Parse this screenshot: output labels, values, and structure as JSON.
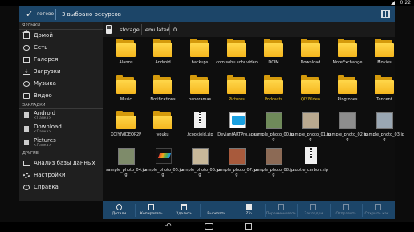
{
  "status": {
    "time": "0:22"
  },
  "actionbar": {
    "done_label": "готово",
    "title": "3 выбрано ресурсов",
    "icons": [
      "check-icon",
      "grid-view-icon"
    ]
  },
  "sidebar": {
    "sections": {
      "bookmarks_header": "ЯРЛЫКИ",
      "tabs_header": "ЗАКЛАДКИ",
      "other_header": "ДРУГИЕ"
    },
    "shortcuts": [
      {
        "label": "Домой",
        "icon": "home-icon"
      },
      {
        "label": "Сеть",
        "icon": "network-icon"
      },
      {
        "label": "Галерея",
        "icon": "gallery-icon"
      },
      {
        "label": "Загрузки",
        "icon": "download-icon"
      },
      {
        "label": "Музыка",
        "icon": "music-icon"
      },
      {
        "label": "Видео",
        "icon": "video-icon"
      }
    ],
    "bookmarks": [
      {
        "label": "Android",
        "sub": "<Папка>"
      },
      {
        "label": "Download",
        "sub": "<Папка>"
      },
      {
        "label": "Pictures",
        "sub": "<Папка>"
      }
    ],
    "other": [
      {
        "label": "Анализ базы данных",
        "icon": "analysis-icon"
      },
      {
        "label": "Настройки",
        "icon": "gear-icon"
      },
      {
        "label": "Справка",
        "icon": "help-icon"
      }
    ]
  },
  "path": {
    "crumbs": [
      "storage",
      "emulated",
      "0"
    ]
  },
  "files": [
    {
      "name": "Alarms",
      "kind": "folder",
      "highlight": false
    },
    {
      "name": "Android",
      "kind": "folder",
      "highlight": false
    },
    {
      "name": "backups",
      "kind": "folder",
      "highlight": false
    },
    {
      "name": "com.sohu.sohuvideo",
      "kind": "folder",
      "highlight": false
    },
    {
      "name": "DCIM",
      "kind": "folder",
      "highlight": false
    },
    {
      "name": "Download",
      "kind": "folder",
      "highlight": false
    },
    {
      "name": "MoreExchange",
      "kind": "folder",
      "highlight": false
    },
    {
      "name": "Movies",
      "kind": "folder",
      "highlight": false
    },
    {
      "name": "Music",
      "kind": "folder",
      "highlight": false
    },
    {
      "name": "Notifications",
      "kind": "folder",
      "highlight": false
    },
    {
      "name": "panoramas",
      "kind": "folder",
      "highlight": false
    },
    {
      "name": "Pictures",
      "kind": "folder",
      "highlight": true
    },
    {
      "name": "Podcasts",
      "kind": "folder",
      "highlight": true
    },
    {
      "name": "QIYIVideo",
      "kind": "folder",
      "highlight": true
    },
    {
      "name": "Ringtones",
      "kind": "folder",
      "highlight": false
    },
    {
      "name": "Tencent",
      "kind": "folder",
      "highlight": false
    },
    {
      "name": "XQIYIVIDEOP2P",
      "kind": "folder",
      "highlight": false
    },
    {
      "name": "youku",
      "kind": "folder",
      "highlight": false
    },
    {
      "name": ".tcookieid.zip",
      "kind": "zip",
      "highlight": false
    },
    {
      "name": "DeviantARTPro.apk",
      "kind": "apk",
      "highlight": false
    },
    {
      "name": "sample_photo_00.jpg",
      "kind": "photo",
      "color": "#6f8a5a",
      "highlight": false
    },
    {
      "name": "sample_photo_01.jpg",
      "kind": "photo",
      "color": "#b9a990",
      "highlight": false
    },
    {
      "name": "sample_photo_02.jpg",
      "kind": "photo",
      "color": "#8d8d8d",
      "highlight": false
    },
    {
      "name": "sample_photo_03.jpg",
      "kind": "photo",
      "color": "#9aa7b3",
      "highlight": false
    },
    {
      "name": "sample_photo_04.jpg",
      "kind": "photo",
      "color": "#7e8b6a",
      "highlight": false
    },
    {
      "name": "sample_photo_05.jpg",
      "kind": "play",
      "highlight": false
    },
    {
      "name": "sample_photo_06.jpg",
      "kind": "photo",
      "color": "#c8b89a",
      "highlight": false
    },
    {
      "name": "sample_photo_07.jpg",
      "kind": "photo",
      "color": "#a85a3c",
      "highlight": false
    },
    {
      "name": "sample_photo_08.jpg",
      "kind": "photo",
      "color": "#8c6a55",
      "highlight": false
    },
    {
      "name": "subtle_carbon.zip",
      "kind": "zip",
      "highlight": false
    }
  ],
  "toolbar": [
    {
      "label": "Детали",
      "icon": "info-icon",
      "enabled": true
    },
    {
      "label": "Копировать",
      "icon": "copy-icon",
      "enabled": true
    },
    {
      "label": "Удалить",
      "icon": "delete-icon",
      "enabled": true
    },
    {
      "label": "Вырезать",
      "icon": "cut-icon",
      "enabled": true
    },
    {
      "label": "Zip",
      "icon": "zip-icon",
      "enabled": true
    },
    {
      "label": "Переименовать",
      "icon": "rename-icon",
      "enabled": false
    },
    {
      "label": "Закладки",
      "icon": "bookmark-icon",
      "enabled": false
    },
    {
      "label": "Отправить",
      "icon": "share-icon",
      "enabled": false
    },
    {
      "label": "Открыть как...",
      "icon": "open-as-icon",
      "enabled": false
    }
  ],
  "navbar": {
    "icons": [
      "back-icon",
      "home-icon",
      "recent-apps-icon"
    ]
  }
}
